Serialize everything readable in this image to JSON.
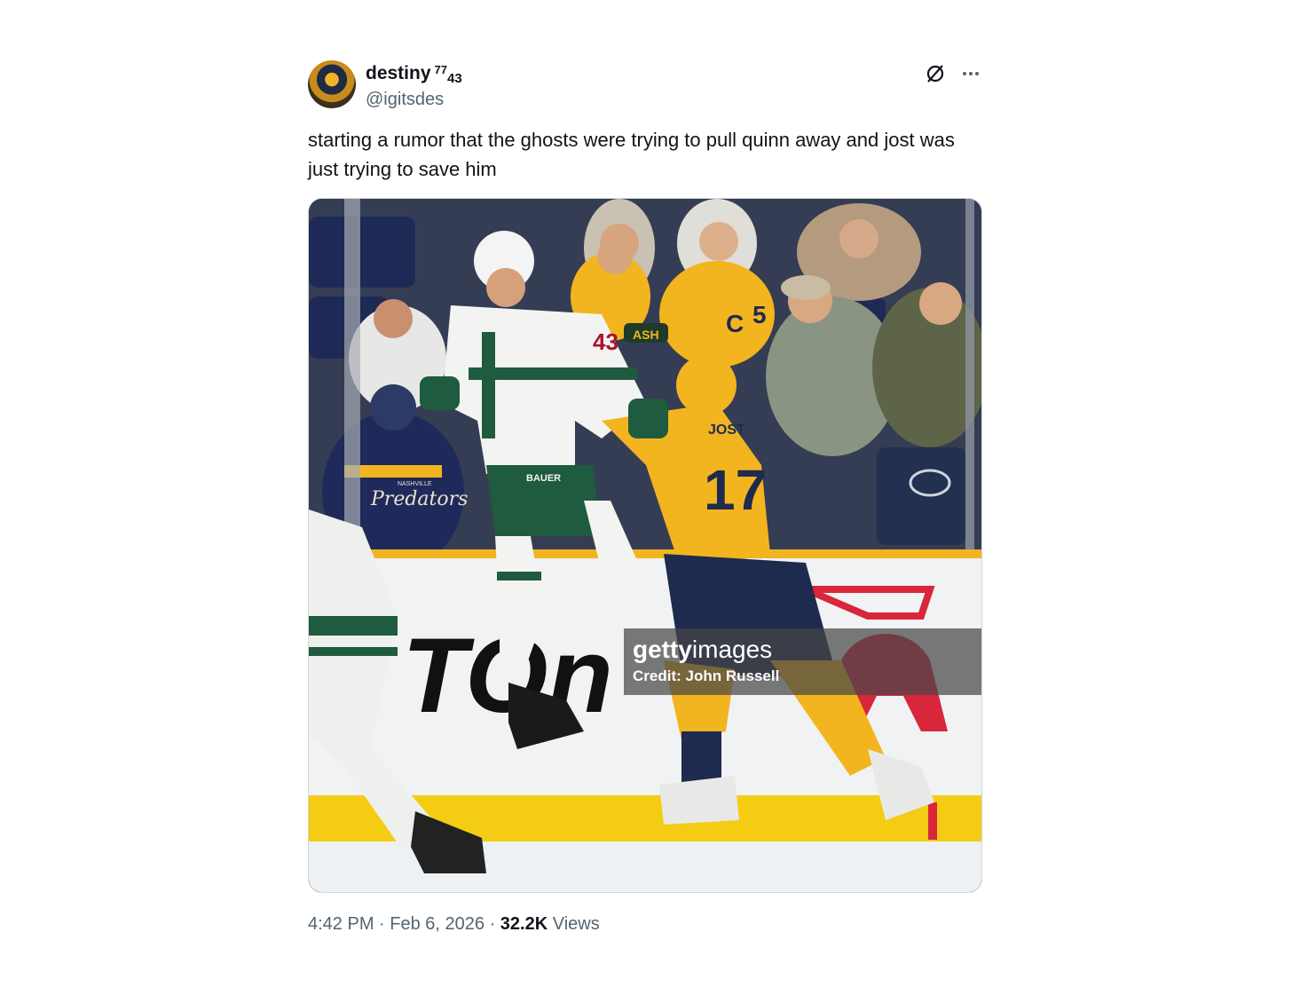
{
  "user": {
    "display_name": "destiny",
    "name_sup": "77",
    "name_sub": "43",
    "handle": "@igitsdes"
  },
  "tweet": {
    "text": "starting a rumor that the ghosts were trying to pull quinn away and jost was just trying to save him"
  },
  "media": {
    "watermark_brand_bold": "getty",
    "watermark_brand_light": "images",
    "watermark_credit": "Credit: John Russell",
    "board_text": "TOn",
    "jersey_front": "43",
    "jersey_back_number": "17",
    "jersey_back_name": "JOST",
    "fan_shirt": "Predators",
    "fan_shirt_top": "NASHVILLE",
    "fan_hat": "ASH",
    "fan_jersey_letter": "C",
    "fan_jersey_number": "5",
    "glove_brand": "BAUER",
    "colors": {
      "gold": "#f2b51f",
      "navy": "#1f2a4f",
      "wild_green": "#1f5b3e",
      "ice": "#f3f5f7",
      "red_logo": "#d8263a"
    }
  },
  "meta": {
    "time": "4:42 PM",
    "sep1": " · ",
    "date": "Feb 6, 2026",
    "sep2": " · ",
    "views_count": "32.2K",
    "views_label": " Views"
  }
}
